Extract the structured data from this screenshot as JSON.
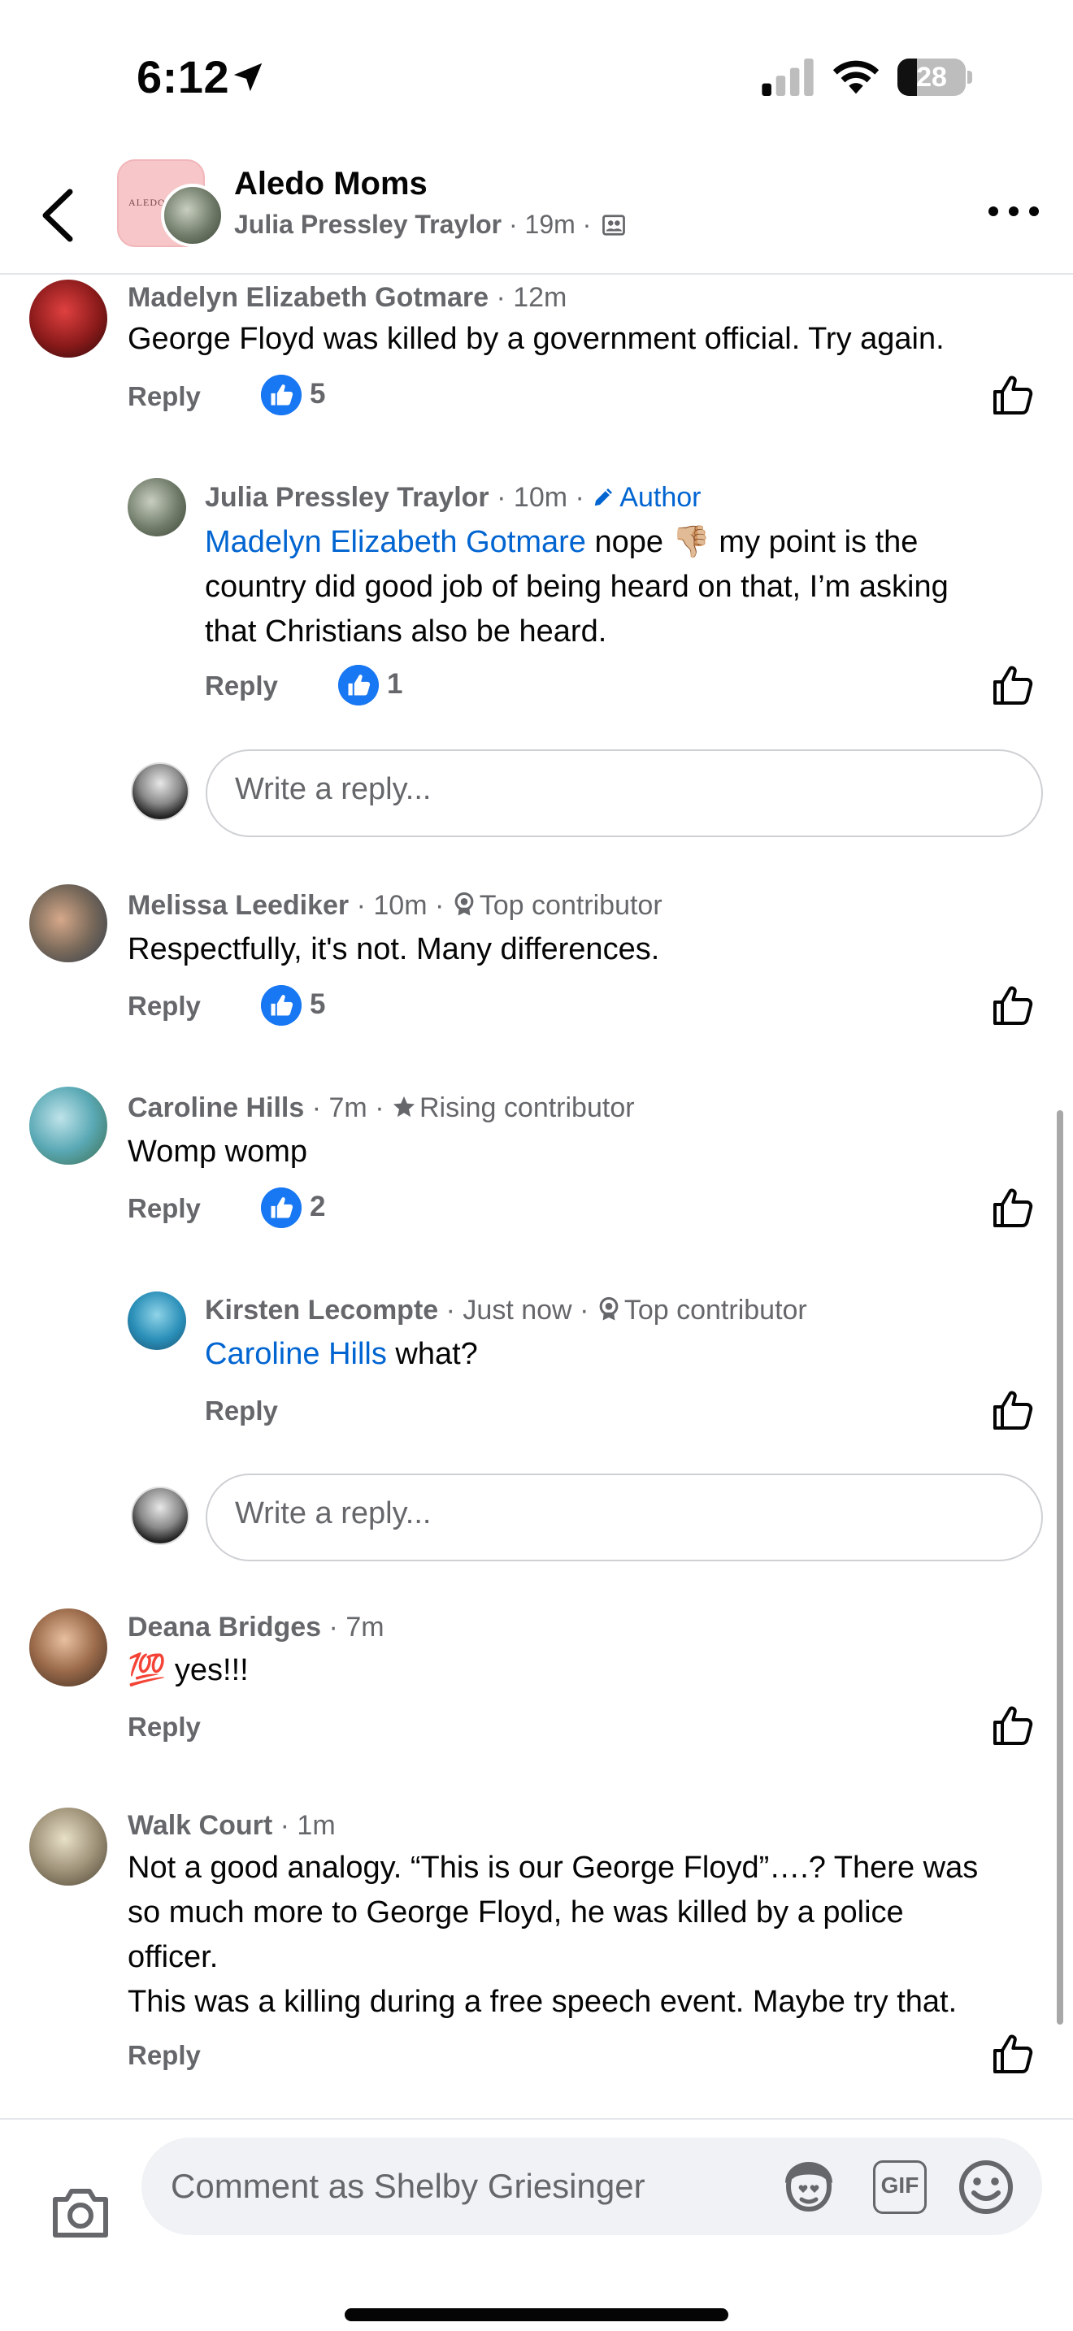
{
  "status_bar": {
    "time": "6:12",
    "battery": "28"
  },
  "header": {
    "group_name": "Aledo Moms",
    "group_avatar_text": "ALEDO",
    "post_author": "Julia Pressley Traylor",
    "post_time": "19m",
    "icons": [
      "back-arrow-icon",
      "location-arrow-icon",
      "privacy-group-icon",
      "more-icon"
    ]
  },
  "comments": [
    {
      "name": "Madelyn Elizabeth Gotmare",
      "time": "12m",
      "text": "George Floyd was killed by a government official. Try again.",
      "reply_label": "Reply",
      "reactions": "5"
    },
    {
      "name": "Julia Pressley Traylor",
      "time": "10m",
      "badge": "Author",
      "mention": "Madelyn Elizabeth Gotmare",
      "text_line1": " nope 👎🏼  my point is the",
      "text_line2": "country did good job of being heard on that, I’m asking",
      "text_line3": "that Christians also be heard.",
      "reply_label": "Reply",
      "reactions": "1"
    },
    {
      "name": "Melissa Leediker",
      "time": "10m",
      "badge": "Top contributor",
      "text": "Respectfully, it's not. Many differences.",
      "reply_label": "Reply",
      "reactions": "5"
    },
    {
      "name": "Caroline Hills",
      "time": "7m",
      "badge": "Rising contributor",
      "text": "Womp womp",
      "reply_label": "Reply",
      "reactions": "2"
    },
    {
      "name": "Kirsten Lecompte",
      "time": "Just now",
      "badge": "Top contributor",
      "mention": "Caroline Hills",
      "text": " what?",
      "reply_label": "Reply"
    },
    {
      "name": "Deana Bridges",
      "time": "7m",
      "text": "💯  yes!!!",
      "reply_label": "Reply"
    },
    {
      "name": "Walk Court",
      "time": "1m",
      "text_line1": "Not a good analogy. “This is our George Floyd”….? There was",
      "text_line2": "so much more to George Floyd, he was killed by a police",
      "text_line3": "officer.",
      "text_line4": "This was a killing during a free speech event. Maybe try that.",
      "reply_label": "Reply"
    }
  ],
  "reply_box": {
    "placeholder": "Write a reply..."
  },
  "composer": {
    "placeholder": "Comment as Shelby Griesinger",
    "gif_label": "GIF",
    "icons": [
      "camera-icon",
      "avatar-sticker-icon",
      "gif-icon",
      "emoji-icon"
    ]
  },
  "colors": {
    "like_blue": "#1877f2",
    "link_blue": "#0064d1",
    "meta_gray": "#65676b",
    "input_bg": "#f0f2f5"
  }
}
